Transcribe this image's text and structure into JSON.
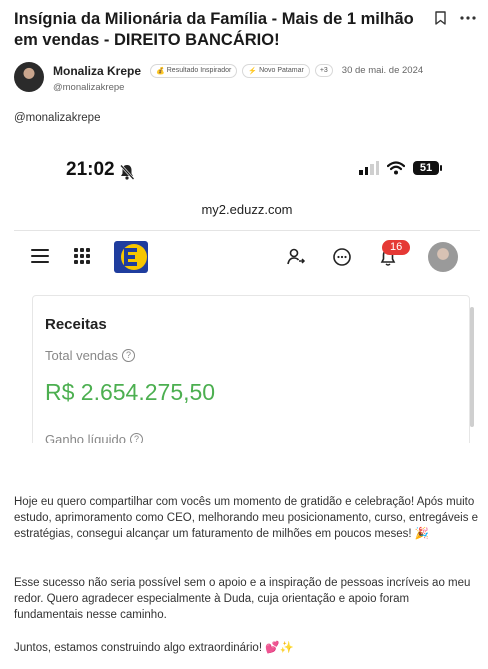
{
  "post": {
    "title": "Insígnia da Milionária da Família - Mais de 1 milhão em vendas - DIREITO BANCÁRIO!",
    "author": {
      "name": "Monaliza Krepe",
      "handle": "@monalizakrepe",
      "badges": [
        "Resultado Inspirador",
        "Novo Patamar"
      ],
      "badge_icons": [
        "money-bag-icon",
        "lightning-icon"
      ],
      "more_badges": "+3",
      "date": "30 de mai. de 2024"
    },
    "mention": "@monalizakrepe",
    "paragraphs": [
      "Hoje eu quero compartilhar com vocês um momento de gratidão e celebração! Após muito estudo, aprimoramento como CEO, melhorando meu posicionamento, curso, entregáveis e estratégias, consegui alcançar um faturamento de milhões em poucos meses! 🎉",
      "Esse sucesso não seria possível sem o apoio e a inspiração de pessoas incríveis ao meu redor. Quero agradecer especialmente à Duda, cuja orientação e apoio foram fundamentais nesse caminho.",
      "Juntos, estamos construindo algo extraordinário! 💕✨"
    ]
  },
  "screenshot": {
    "status_time": "21:02",
    "battery": "51",
    "url": "my2.eduzz.com",
    "notifications_count": "16",
    "card": {
      "title": "Receitas",
      "total_label": "Total vendas",
      "total_value": "R$ 2.654.275,50",
      "net_label": "Ganho líquido",
      "value_color": "#4caf50"
    },
    "logo_colors": {
      "blue": "#1f3d9e",
      "yellow": "#f7c600"
    }
  },
  "icons": [
    "bookmark-icon",
    "more-options-icon",
    "bell-off-icon",
    "signal-icon",
    "wifi-icon",
    "battery-icon",
    "menu-icon",
    "apps-icon",
    "user-switch-icon",
    "chat-icon",
    "bell-icon"
  ]
}
